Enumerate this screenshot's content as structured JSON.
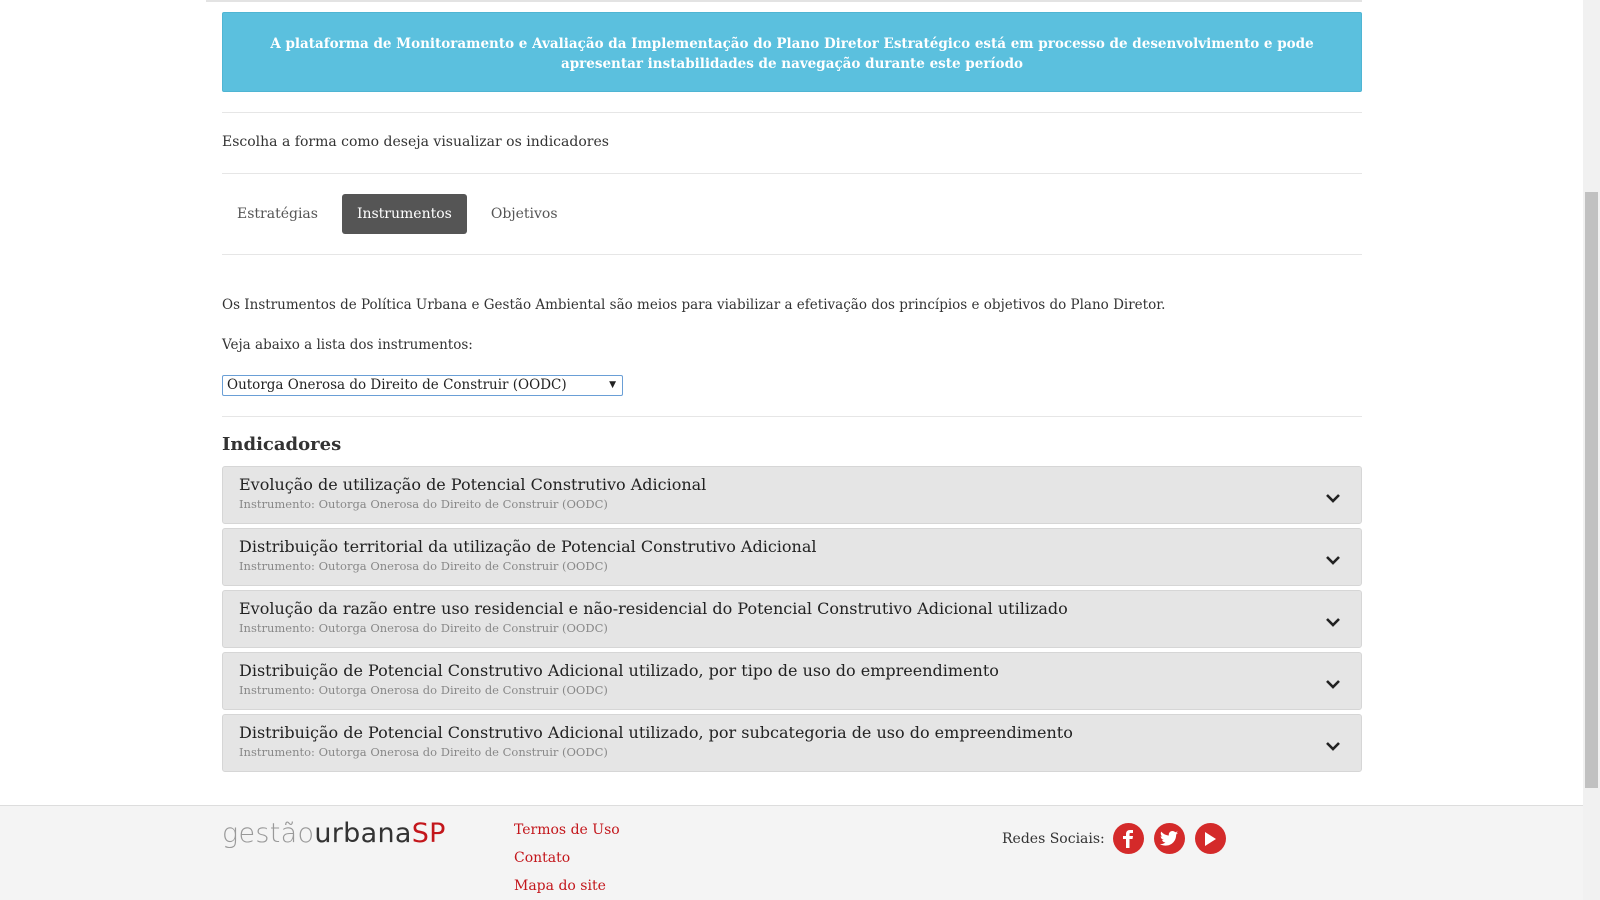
{
  "alert": {
    "text": "A plataforma de Monitoramento e Avaliação da Implementação do Plano Diretor Estratégico está em processo de desenvolvimento e pode apresentar instabilidades de navegação durante este período"
  },
  "intro": "Escolha a forma como deseja visualizar os indicadores",
  "tabs": [
    {
      "label": "Estratégias"
    },
    {
      "label": "Instrumentos",
      "active": true
    },
    {
      "label": "Objetivos"
    }
  ],
  "description": "Os Instrumentos de Política Urbana e Gestão Ambiental são meios para viabilizar a efetivação dos princípios e objetivos do Plano Diretor.",
  "see_below": "Veja abaixo a lista dos instrumentos:",
  "select": {
    "value": "Outorga Onerosa do Direito de Construir (OODC)"
  },
  "indicators": {
    "heading": "Indicadores",
    "items": [
      {
        "title": "Evolução de utilização de Potencial Construtivo Adicional",
        "subtitle": "Instrumento: Outorga Onerosa do Direito de Construir (OODC)"
      },
      {
        "title": "Distribuição territorial da utilização de Potencial Construtivo Adicional",
        "subtitle": "Instrumento: Outorga Onerosa do Direito de Construir (OODC)"
      },
      {
        "title": "Evolução da razão entre uso residencial e não-residencial do Potencial Construtivo Adicional utilizado",
        "subtitle": "Instrumento: Outorga Onerosa do Direito de Construir (OODC)"
      },
      {
        "title": "Distribuição de Potencial Construtivo Adicional utilizado, por tipo de uso do empreendimento",
        "subtitle": "Instrumento: Outorga Onerosa do Direito de Construir (OODC)"
      },
      {
        "title": "Distribuição de Potencial Construtivo Adicional utilizado, por subcategoria de uso do empreendimento",
        "subtitle": "Instrumento: Outorga Onerosa do Direito de Construir (OODC)"
      }
    ]
  },
  "footer": {
    "logo": {
      "part1": "gestão",
      "part2": "urbana",
      "part3": "SP"
    },
    "links": [
      "Termos de Uso",
      "Contato",
      "Mapa do site"
    ],
    "social_label": "Redes Sociais:",
    "social_icons": [
      "facebook-icon",
      "twitter-icon",
      "youtube-icon"
    ],
    "accent_color": "#c3161b"
  },
  "colors": {
    "alert_bg": "#5bc0de",
    "active_tab": "#555555",
    "accordion_bg": "#e5e5e5"
  }
}
